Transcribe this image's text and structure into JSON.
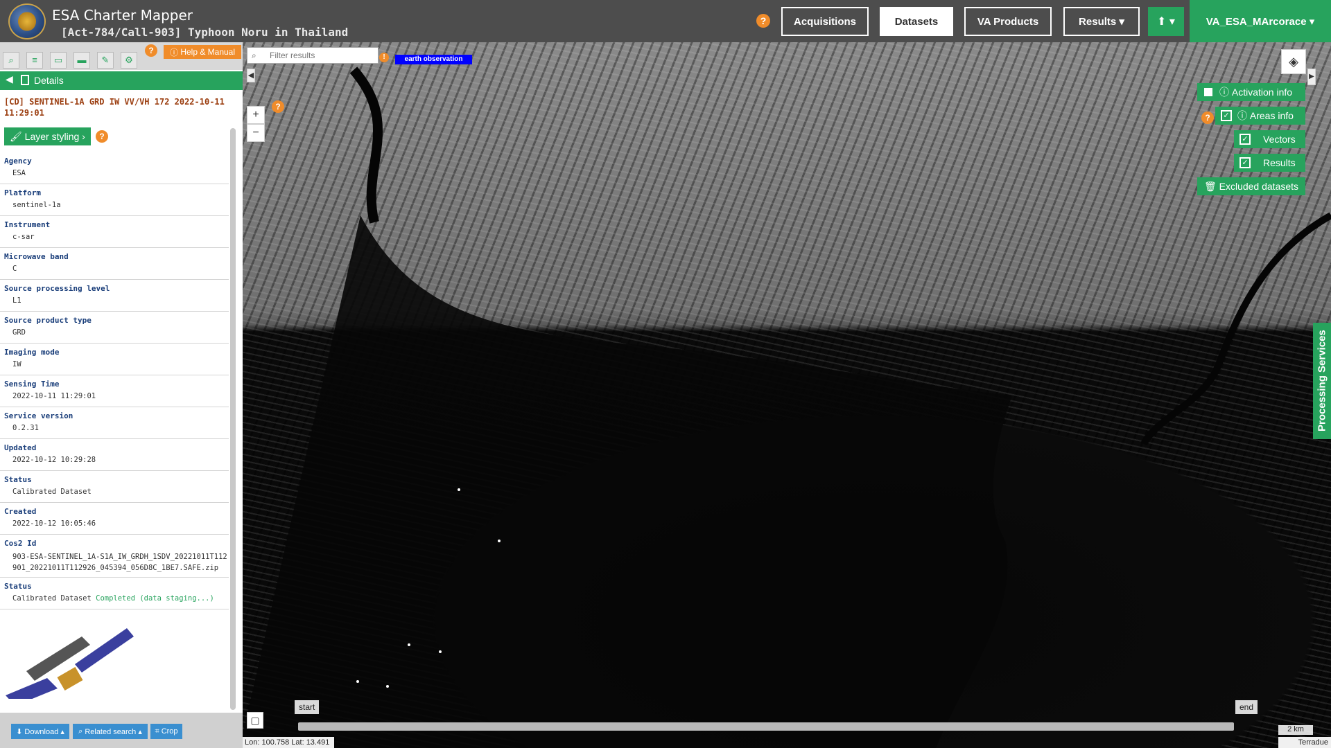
{
  "header": {
    "app_title": "ESA Charter Mapper",
    "activation_title": "[Act-784/Call-903] Typhoon Noru in Thailand",
    "nav": [
      "Acquisitions",
      "Datasets",
      "VA Products",
      "Results"
    ],
    "results_label": "Results ▾",
    "upload_icon": "upload-icon",
    "user_label": "VA_ESA_MArcorace ▾"
  },
  "left": {
    "help_manual": "Help & Manual",
    "details_label": "Details",
    "dataset_title": "[CD] SENTINEL-1A GRD IW VV/VH 172 2022-10-11 11:29:01",
    "layer_styling": "Layer styling",
    "fields": [
      {
        "k": "Agency",
        "v": "ESA"
      },
      {
        "k": "Platform",
        "v": "sentinel-1a"
      },
      {
        "k": "Instrument",
        "v": "c-sar"
      },
      {
        "k": "Microwave band",
        "v": "C"
      },
      {
        "k": "Source processing level",
        "v": "L1"
      },
      {
        "k": "Source product type",
        "v": "GRD"
      },
      {
        "k": "Imaging mode",
        "v": "IW"
      },
      {
        "k": "Sensing Time",
        "v": "2022-10-11 11:29:01"
      },
      {
        "k": "Service version",
        "v": "0.2.31"
      },
      {
        "k": "Updated",
        "v": "2022-10-12 10:29:28"
      },
      {
        "k": "Status",
        "v": "Calibrated Dataset"
      },
      {
        "k": "Created",
        "v": "2022-10-12 10:05:46"
      },
      {
        "k": "Cos2 Id",
        "v": "903-ESA-SENTINEL_1A-S1A_IW_GRDH_1SDV_20221011T112901_20221011T112926_045394_056D8C_1BE7.SAFE.zip"
      },
      {
        "k": "Status",
        "v": "Calibrated Dataset",
        "extra": "Completed (data staging...)"
      }
    ],
    "buttons": [
      "Download ▴",
      "Related search ▴",
      "Crop"
    ]
  },
  "map": {
    "filter_placeholder": "Filter results",
    "eo_badge": "earth observation",
    "zoom_in": "+",
    "zoom_out": "−",
    "toggles": [
      {
        "label": "Activation info",
        "checked": false
      },
      {
        "label": "Areas info",
        "checked": true
      },
      {
        "label": "Vectors",
        "checked": true
      },
      {
        "label": "Results",
        "checked": true
      }
    ],
    "excluded": "Excluded datasets",
    "processing": "Processing Services",
    "timeline_start": "start",
    "timeline_end": "end",
    "coords": "Lon: 100.758 Lat: 13.491",
    "scale": "2 km",
    "attribution": "Terradue"
  },
  "colors": {
    "accent_green": "#27a35d",
    "help_orange": "#f08c2a",
    "title_brown": "#9b3d0f",
    "key_blue": "#1a3e7a"
  }
}
